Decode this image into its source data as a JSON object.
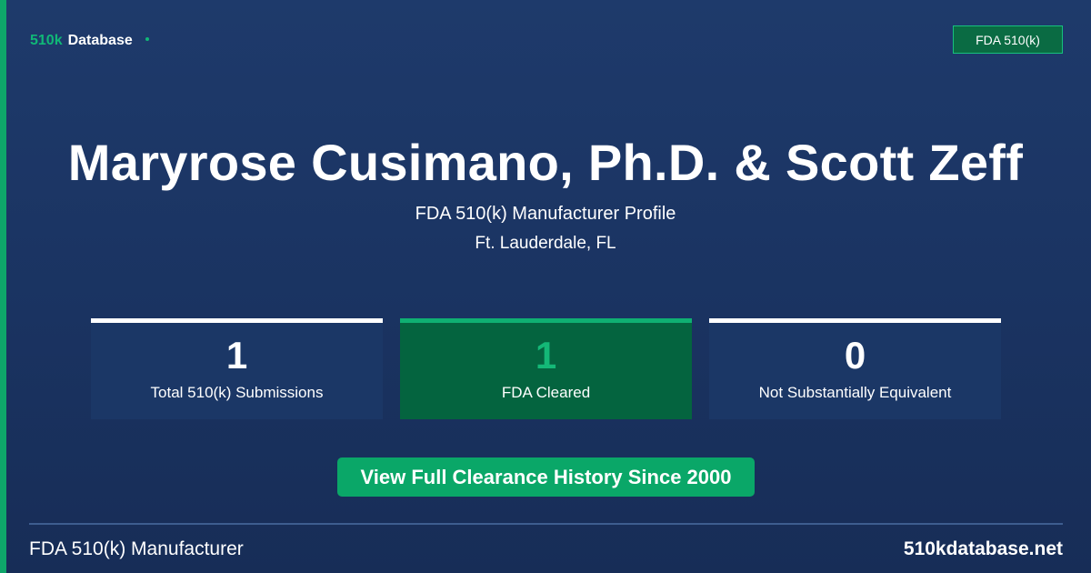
{
  "brand": {
    "part1": "510k",
    "part2": "Database"
  },
  "badge": {
    "label": "FDA 510(k)"
  },
  "manufacturer": {
    "name": "Maryrose Cusimano, Ph.D. & Scott Zeff",
    "subtitle": "FDA 510(k) Manufacturer Profile",
    "location": "Ft. Lauderdale, FL"
  },
  "stats": [
    {
      "value": "1",
      "label": "Total 510(k) Submissions"
    },
    {
      "value": "1",
      "label": "FDA Cleared"
    },
    {
      "value": "0",
      "label": "Not Substantially Equivalent"
    }
  ],
  "cta": {
    "label": "View Full Clearance History Since 2000"
  },
  "footer": {
    "left": "FDA 510(k) Manufacturer",
    "right": "510kdatabase.net"
  },
  "colors": {
    "accent": "#0ea66a",
    "background": "#1e3a6b",
    "cleared_card": "#04643f",
    "cleared_number": "#14b877"
  }
}
